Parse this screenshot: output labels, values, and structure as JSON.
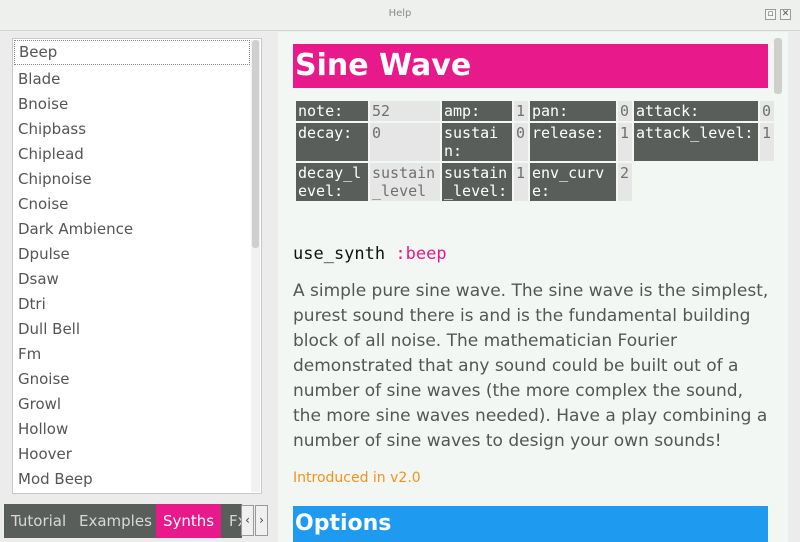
{
  "window": {
    "title": "Help"
  },
  "synth_list": {
    "items": [
      "Beep",
      "Blade",
      "Bnoise",
      "Chipbass",
      "Chiplead",
      "Chipnoise",
      "Cnoise",
      "Dark Ambience",
      "Dpulse",
      "Dsaw",
      "Dtri",
      "Dull Bell",
      "Fm",
      "Gnoise",
      "Growl",
      "Hollow",
      "Hoover",
      "Mod Beep"
    ],
    "selected": "Beep"
  },
  "tabs": [
    "Tutorial",
    "Examples",
    "Synths",
    "Fx"
  ],
  "active_tab": "Synths",
  "doc": {
    "title": "Sine Wave",
    "params": [
      [
        {
          "name": "note:",
          "value": "52"
        },
        {
          "name": "amp:",
          "value": "1"
        },
        {
          "name": "pan:",
          "value": "0"
        },
        {
          "name": "attack:",
          "value": "0"
        }
      ],
      [
        {
          "name": "decay:",
          "value": "0"
        },
        {
          "name": "sustain:",
          "value": "0"
        },
        {
          "name": "release:",
          "value": "1"
        },
        {
          "name": "attack_level:",
          "value": "1"
        }
      ],
      [
        {
          "name": "decay_level:",
          "value": "sustain_level"
        },
        {
          "name": "sustain_level:",
          "value": "1"
        },
        {
          "name": "env_curve:",
          "value": "2"
        }
      ]
    ],
    "use_synth_keyword": "use_synth",
    "use_synth_symbol": ":beep",
    "description": "A simple pure sine wave. The sine wave is the simplest, purest sound there is and is the fundamental building block of all noise. The mathematician Fourier demonstrated that any sound could be built out of a number of sine waves (the more complex the sound, the more sine waves needed). Have a play combining a number of sine waves to design your own sounds!",
    "introduced": "Introduced in v2.0",
    "options_heading": "Options"
  },
  "colors": {
    "accent_pink": "#e8198b",
    "heading_blue": "#1e9bf0",
    "introduced_orange": "#f5911a",
    "param_dark": "#5a5e5b"
  },
  "icons": {
    "restore": "restore-icon",
    "close": "close-icon",
    "left": "chevron-left-icon",
    "right": "chevron-right-icon"
  }
}
